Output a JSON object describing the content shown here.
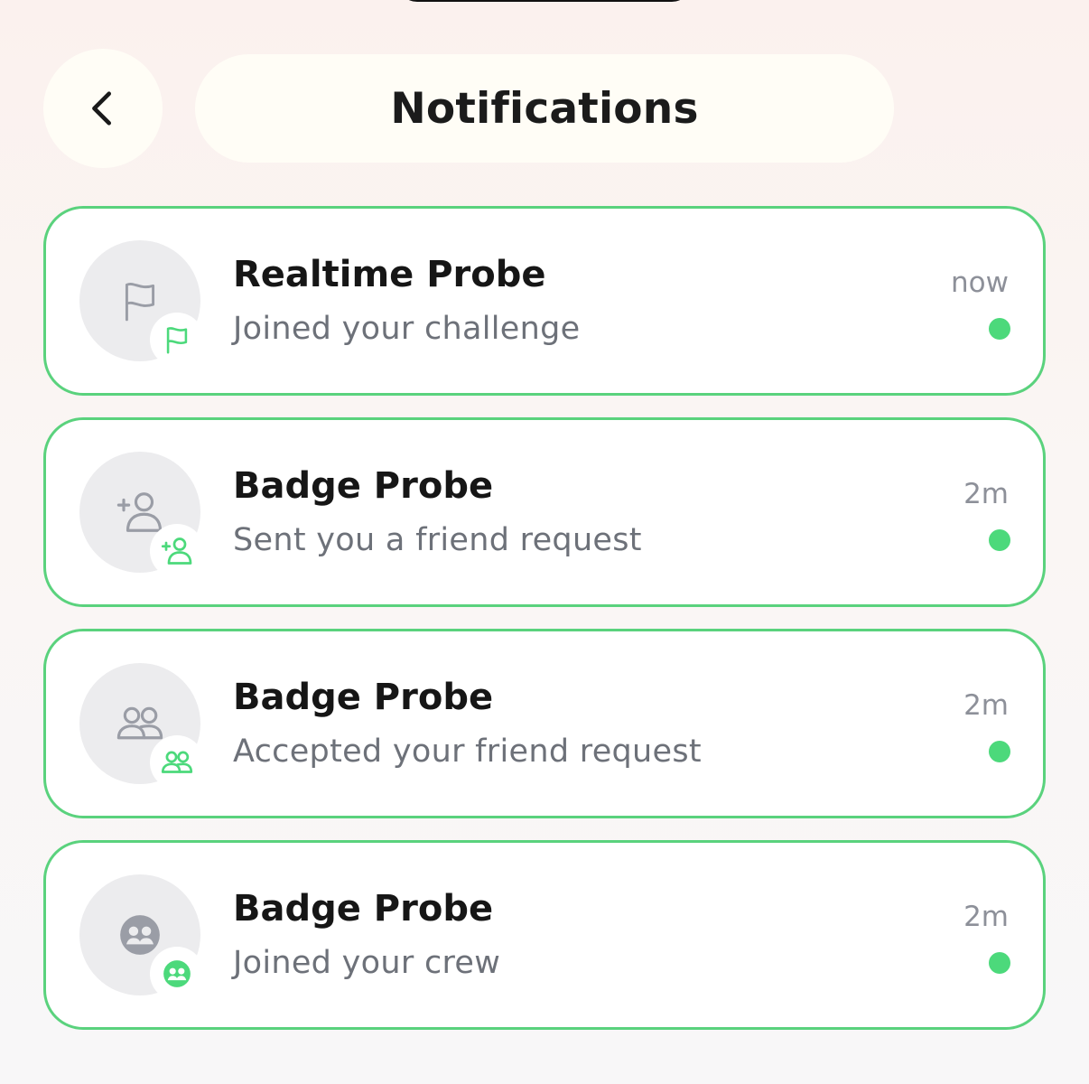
{
  "header": {
    "back_icon": "chevron-left-icon",
    "title": "Notifications"
  },
  "colors": {
    "accent": "#4cd97b",
    "card_border": "#5ad27d",
    "header_pill": "#fffdf6"
  },
  "notifications": [
    {
      "name": "Realtime Probe",
      "message": "Joined your challenge",
      "time": "now",
      "icon": "flag-icon",
      "unread": true
    },
    {
      "name": "Badge Probe",
      "message": "Sent you a friend request",
      "time": "2m",
      "icon": "add-friend-icon",
      "unread": true
    },
    {
      "name": "Badge Probe",
      "message": "Accepted your friend request",
      "time": "2m",
      "icon": "friends-icon",
      "unread": true
    },
    {
      "name": "Badge Probe",
      "message": "Joined your crew",
      "time": "2m",
      "icon": "crew-icon",
      "unread": true
    }
  ]
}
